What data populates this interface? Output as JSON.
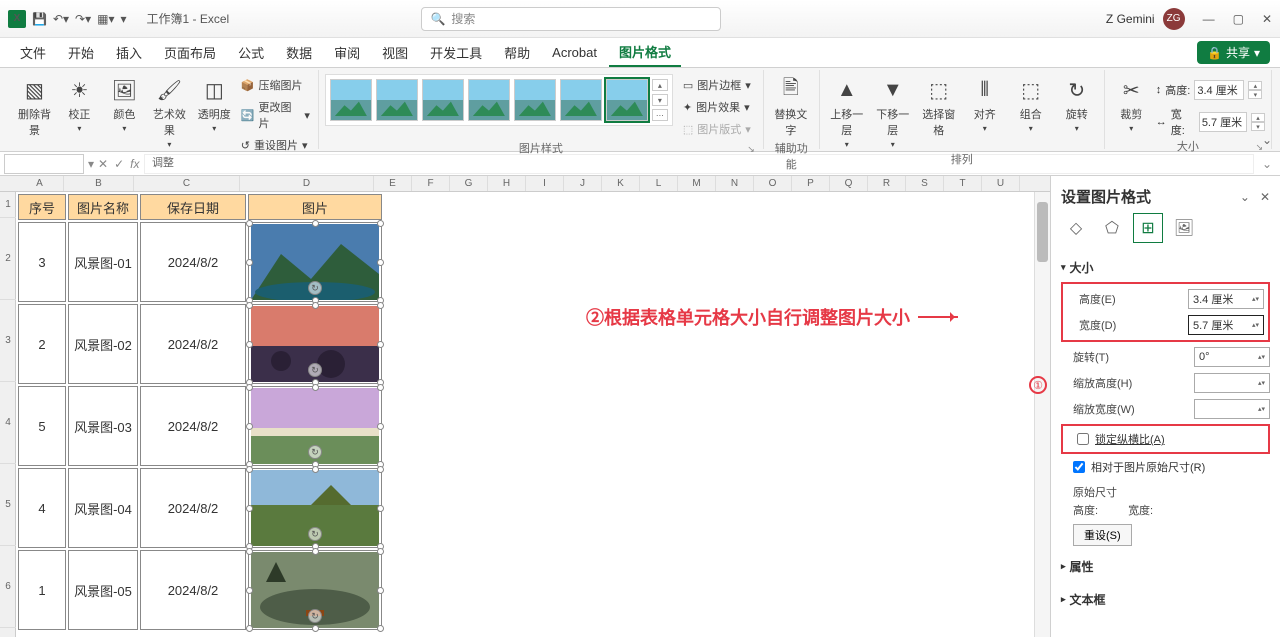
{
  "titlebar": {
    "title": "工作簿1 - Excel",
    "search_placeholder": "搜索",
    "user_name": "Z Gemini",
    "user_initials": "ZG"
  },
  "tabs": {
    "file": "文件",
    "home": "开始",
    "insert": "插入",
    "layout": "页面布局",
    "formula": "公式",
    "data": "数据",
    "review": "审阅",
    "view": "视图",
    "dev": "开发工具",
    "help": "帮助",
    "acrobat": "Acrobat",
    "picformat": "图片格式",
    "share": "共享"
  },
  "ribbon": {
    "remove_bg": "删除背景",
    "correct": "校正",
    "color": "颜色",
    "artistic": "艺术效果",
    "transparency": "透明度",
    "compress": "压缩图片",
    "change": "更改图片",
    "reset": "重设图片",
    "grp_adjust": "调整",
    "grp_styles": "图片样式",
    "grp_access": "辅助功能",
    "grp_arrange": "排列",
    "grp_size": "大小",
    "pic_border": "图片边框",
    "pic_effect": "图片效果",
    "pic_layout": "图片版式",
    "alt_text": "替换文字",
    "bring_fwd": "上移一层",
    "send_back": "下移一层",
    "sel_pane": "选择窗格",
    "align": "对齐",
    "group": "组合",
    "rotate": "旋转",
    "crop": "裁剪",
    "height_lbl": "高度:",
    "width_lbl": "宽度:",
    "height_val": "3.4 厘米",
    "width_val": "5.7 厘米"
  },
  "cols": [
    "A",
    "B",
    "C",
    "D",
    "E",
    "F",
    "G",
    "H",
    "I",
    "J",
    "K",
    "L",
    "M",
    "N",
    "O",
    "P",
    "Q",
    "R",
    "S",
    "T",
    "U"
  ],
  "rows": [
    "1",
    "2",
    "3",
    "4",
    "5",
    "6"
  ],
  "table": {
    "h_seq": "序号",
    "h_name": "图片名称",
    "h_date": "保存日期",
    "h_pic": "图片",
    "data": [
      {
        "seq": "3",
        "name": "风景图-01",
        "date": "2024/8/2"
      },
      {
        "seq": "2",
        "name": "风景图-02",
        "date": "2024/8/2"
      },
      {
        "seq": "5",
        "name": "风景图-03",
        "date": "2024/8/2"
      },
      {
        "seq": "4",
        "name": "风景图-04",
        "date": "2024/8/2"
      },
      {
        "seq": "1",
        "name": "风景图-05",
        "date": "2024/8/2"
      }
    ]
  },
  "annotation": {
    "step2": "②根据表格单元格大小自行调整图片大小",
    "step1": "①"
  },
  "pane": {
    "title": "设置图片格式",
    "sec_size": "大小",
    "sec_prop": "属性",
    "sec_textbox": "文本框",
    "height": "高度(E)",
    "width": "宽度(D)",
    "rotate": "旋转(T)",
    "scale_h": "缩放高度(H)",
    "scale_w": "缩放宽度(W)",
    "height_v": "3.4 厘米",
    "width_v": "5.7 厘米",
    "rotate_v": "0°",
    "scale_h_v": "",
    "scale_w_v": "",
    "lock": "锁定纵横比(A)",
    "relative": "相对于图片原始尺寸(R)",
    "orig": "原始尺寸",
    "orig_h": "高度:",
    "orig_w": "宽度:",
    "reset": "重设(S)"
  }
}
